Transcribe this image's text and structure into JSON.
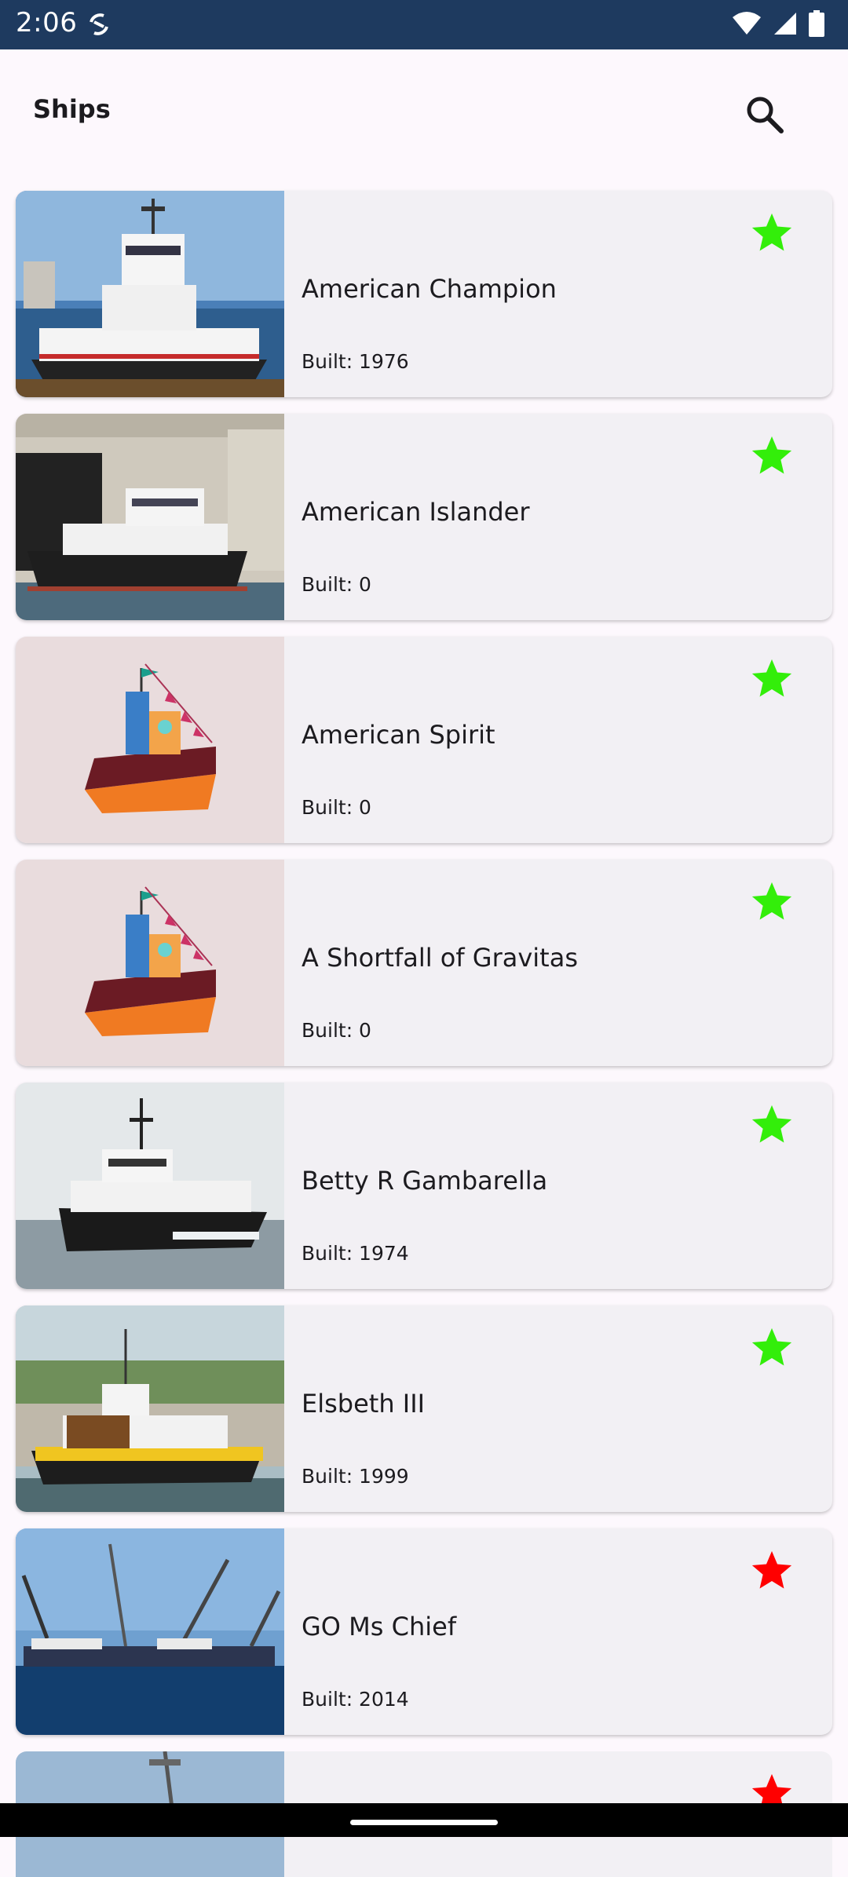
{
  "status_bar": {
    "time": "2:06",
    "icons": [
      "sync-icon",
      "wifi-icon",
      "signal-icon",
      "battery-icon"
    ]
  },
  "app_bar": {
    "title": "Ships",
    "search_icon": "search-icon"
  },
  "colors": {
    "status_bar": "#1e3a5f",
    "background": "#fdf8fd",
    "card": "#f2f0f4",
    "favorite_star": "#33ee0a",
    "not_favorite_star": "#ff0000"
  },
  "ships": [
    {
      "name": "American Champion",
      "built": "Built: 1976",
      "favorite": true,
      "image": "photo-tugboat-white-red"
    },
    {
      "name": "American Islander",
      "built": "Built: 0",
      "favorite": true,
      "image": "photo-tugboat-dock"
    },
    {
      "name": "American Spirit",
      "built": "Built: 0",
      "favorite": true,
      "image": "placeholder-boat-illustration"
    },
    {
      "name": "A Shortfall of Gravitas",
      "built": "Built: 0",
      "favorite": true,
      "image": "placeholder-boat-illustration"
    },
    {
      "name": "Betty R Gambarella",
      "built": "Built: 1974",
      "favorite": true,
      "image": "photo-tugboat-black"
    },
    {
      "name": "Elsbeth III",
      "built": "Built: 1999",
      "favorite": true,
      "image": "photo-tugboat-yellow"
    },
    {
      "name": "GO Ms Chief",
      "built": "Built: 2014",
      "favorite": false,
      "image": "photo-ship-crane-arms"
    }
  ],
  "partial_ship": {
    "favorite": false,
    "image": "photo-ship-crane"
  }
}
